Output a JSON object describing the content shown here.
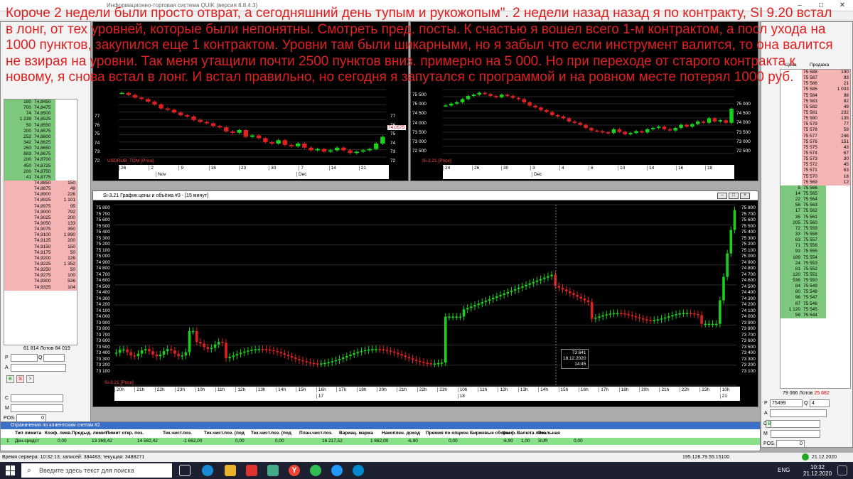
{
  "window": {
    "title": "Информационно-торговая система QUIK (версия 8.8.4.3)"
  },
  "overlay_text": "Короче 2 недели были просто отврат, а сегодняшний день тупым и рукожопым\". 2 недели назад назад я по контракту, SI 9.20 встал в лонг, от тех уровней, которые были непонятны. Смотреть пред. посты. К счастью я вошел всего 1-м контрактом, а посл ухода на 1000 пунктов, закупился еще 1 контрактом. Уровни там были шикарными, но я забыл что если инструмент валится, то она валится не взирая на уровни. Так меня утащили почти 2500 пунктов вниз. примерно на 5 000. Но при переходе от старого контракта к новому, я снова встал в лонг. И встал правильно, но сегодня я запутался с программой и на ровном месте потерял 1000 руб.",
  "left_book": {
    "bids": [
      [
        "180",
        "74,8450",
        ""
      ],
      [
        "700",
        "74,8475",
        ""
      ],
      [
        "74",
        "74,8500",
        ""
      ],
      [
        "1 239",
        "74,8525",
        ""
      ],
      [
        "50",
        "74,8550",
        ""
      ],
      [
        "200",
        "74,8575",
        ""
      ],
      [
        "252",
        "74,8600",
        ""
      ],
      [
        "342",
        "74,8625",
        ""
      ],
      [
        "250",
        "74,8650",
        ""
      ],
      [
        "883",
        "74,8675",
        ""
      ],
      [
        "200",
        "74,8700",
        ""
      ],
      [
        "450",
        "74,8725",
        ""
      ],
      [
        "200",
        "74,8750",
        ""
      ],
      [
        "41",
        "74,8775",
        ""
      ]
    ],
    "asks": [
      [
        "",
        "74,8850",
        "150"
      ],
      [
        "",
        "74,8875",
        "49"
      ],
      [
        "",
        "74,8900",
        "226"
      ],
      [
        "",
        "74,8925",
        "1 101"
      ],
      [
        "",
        "74,8975",
        "95"
      ],
      [
        "",
        "74,9000",
        "792"
      ],
      [
        "",
        "74,9025",
        "200"
      ],
      [
        "",
        "74,9050",
        "133"
      ],
      [
        "",
        "74,9075",
        "350"
      ],
      [
        "",
        "74,9100",
        "1 890"
      ],
      [
        "",
        "74,9125",
        "200"
      ],
      [
        "",
        "74,9150",
        "150"
      ],
      [
        "",
        "74,9175",
        "50"
      ],
      [
        "",
        "74,9200",
        "126"
      ],
      [
        "",
        "74,9225",
        "1 352"
      ],
      [
        "",
        "74,9250",
        "50"
      ],
      [
        "",
        "74,9275",
        "100"
      ],
      [
        "",
        "74,9300",
        "526"
      ],
      [
        "",
        "74,9325",
        "104"
      ]
    ],
    "totals": "61 814  Лотов  84 019",
    "labels": {
      "p": "P",
      "q": "Q",
      "a": "A",
      "c": "C",
      "m": "M",
      "pos": "POS.",
      "pos_val": "0",
      "o": "O"
    }
  },
  "usdrub_chart": {
    "axis": [
      "77",
      "76",
      "75",
      "74",
      "73",
      "72"
    ],
    "price_tag": "74,0575",
    "legend": "USDRUB_TOM [Price]",
    "x": [
      "26",
      "2",
      "9",
      "16",
      "23",
      "30",
      "7",
      "14",
      "21"
    ],
    "months": [
      "Nov",
      "Dec"
    ]
  },
  "si_top_chart": {
    "axis": [
      "75 500",
      "75 000",
      "74 500",
      "74 000",
      "73 500",
      "73 000",
      "72 500"
    ],
    "right_axis": [
      "75 000",
      "74 500",
      "74 000",
      "73 500",
      "73 000",
      "72 500"
    ],
    "legend": "Si-3.21 [Price]",
    "x": [
      "24",
      "26",
      "30",
      "3",
      "4",
      "8",
      "10",
      "14",
      "16",
      "18"
    ],
    "months": [
      "Dec"
    ]
  },
  "main_chart": {
    "title": "Si-3.21 График цены и объёма #3 - [15 минут]",
    "axis": [
      "75 800",
      "75 700",
      "75 600",
      "75 500",
      "75 400",
      "75 300",
      "75 200",
      "75 100",
      "75 000",
      "74 900",
      "74 800",
      "74 700",
      "74 600",
      "74 500",
      "74 400",
      "74 300",
      "74 200",
      "74 100",
      "74 000",
      "73 900",
      "73 800",
      "73 700",
      "73 600",
      "73 500",
      "73 400",
      "73 300",
      "73 200",
      "73 100"
    ],
    "legend": "Si-3.21 [Price]",
    "cursor": [
      "73 641",
      "18.12.2020",
      "14:45"
    ],
    "x": [
      "20h",
      "21h",
      "22h",
      "23h",
      "10h",
      "11h",
      "12h",
      "13h",
      "14h",
      "15h",
      "16h",
      "17h",
      "18h",
      "20h",
      "21h",
      "22h",
      "23h",
      "10h",
      "11h",
      "12h",
      "13h",
      "14h",
      "15h",
      "16h",
      "17h",
      "18h",
      "20h",
      "21h",
      "22h",
      "23h",
      "10h"
    ],
    "days": {
      "10": "17",
      "17": "18",
      "30": "21"
    }
  },
  "right_book": {
    "headers": [
      "Цена",
      "Продажа"
    ],
    "asks": [
      [
        "75 588",
        "100"
      ],
      [
        "75 587",
        "93"
      ],
      [
        "75 586",
        "21"
      ],
      [
        "75 585",
        "1 033"
      ],
      [
        "75 584",
        "98"
      ],
      [
        "75 583",
        "82"
      ],
      [
        "75 582",
        "49"
      ],
      [
        "75 581",
        "232"
      ],
      [
        "75 580",
        "135"
      ],
      [
        "75 579",
        "77"
      ],
      [
        "75 578",
        "59"
      ],
      [
        "75 577",
        "246"
      ],
      [
        "75 576",
        "151"
      ],
      [
        "75 575",
        "43"
      ],
      [
        "75 574",
        "67"
      ],
      [
        "75 573",
        "30"
      ],
      [
        "75 572",
        "45"
      ],
      [
        "75 571",
        "63"
      ],
      [
        "75 570",
        "18"
      ],
      [
        "75 569",
        "12"
      ]
    ],
    "bids": [
      [
        "5",
        "75 566"
      ],
      [
        "14",
        "75 565"
      ],
      [
        "22",
        "75 564"
      ],
      [
        "58",
        "75 563"
      ],
      [
        "17",
        "75 562"
      ],
      [
        "35",
        "75 561"
      ],
      [
        "205",
        "75 560"
      ],
      [
        "72",
        "75 559"
      ],
      [
        "33",
        "75 558"
      ],
      [
        "63",
        "75 557"
      ],
      [
        "71",
        "75 556"
      ],
      [
        "93",
        "75 555"
      ],
      [
        "189",
        "75 554"
      ],
      [
        "24",
        "75 553"
      ],
      [
        "81",
        "75 552"
      ],
      [
        "120",
        "75 551"
      ],
      [
        "536",
        "75 550"
      ],
      [
        "84",
        "75 549"
      ],
      [
        "80",
        "75 548"
      ],
      [
        "96",
        "75 547"
      ],
      [
        "87",
        "75 546"
      ],
      [
        "1 120",
        "75 545"
      ],
      [
        "59",
        "75 544"
      ]
    ],
    "totals": [
      "79 066",
      "Лотов",
      "25 682"
    ],
    "price_input": "75499",
    "qty_input": "4",
    "labels": {
      "p": "P",
      "q": "Q",
      "a": "A",
      "c": "C",
      "m": "M",
      "pos": "POS.",
      "pos_val": "0"
    }
  },
  "limits": {
    "title": "Ограничения по клиентским счетам #2",
    "columns": [
      "Тип лимита",
      "Коэф. ликв.",
      "Предыд. лимит",
      "Лимит откр. поз.",
      "Тек.чист.поз.",
      "Тек.чист.поз. (под",
      "Тек.чист.поз. (под",
      "План.чист.поз.",
      "Вариац. маржа",
      "Накоплен. доход",
      "Премия по опцион",
      "Биржевые сборы",
      "Коэф.",
      "Валюта лим.",
      "Реальная"
    ],
    "row": [
      "1",
      "Ден.средст",
      "0,00",
      "13 368,42",
      "14 562,42",
      "-1 662,00",
      "0,00",
      "0,00",
      "16 217,52",
      "1 662,00",
      "-6,90",
      "0,00",
      "-6,90",
      "1,00",
      "SUR",
      "0,00"
    ]
  },
  "status": {
    "server_time": "Время сервера: 10:32:13; записей: 384483; текущая: 3488271",
    "connection": "195.128.79.55:15100",
    "date": "21.12.2020"
  },
  "taskbar": {
    "search_placeholder": "Введите здесь текст для поиска",
    "lang": "ENG",
    "time": "10:32",
    "date": "21.12.2020"
  }
}
